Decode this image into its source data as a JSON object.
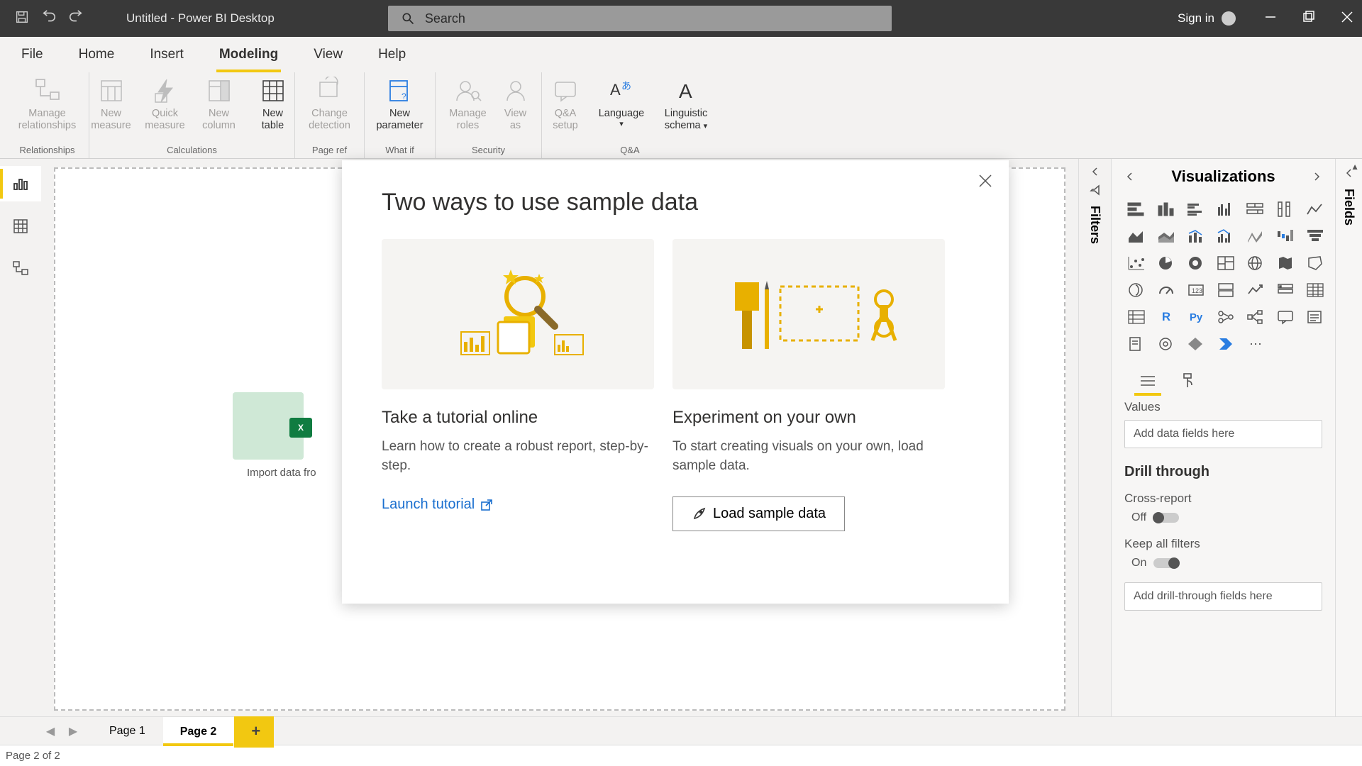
{
  "titlebar": {
    "title": "Untitled - Power BI Desktop",
    "search_placeholder": "Search",
    "signin": "Sign in"
  },
  "menus": [
    "File",
    "Home",
    "Insert",
    "Modeling",
    "View",
    "Help"
  ],
  "menu_active": "Modeling",
  "ribbon": {
    "groups": [
      {
        "label": "Relationships",
        "items": [
          {
            "label1": "Manage",
            "label2": "relationships",
            "disabled": true
          }
        ]
      },
      {
        "label": "Calculations",
        "items": [
          {
            "label1": "New",
            "label2": "measure",
            "disabled": true
          },
          {
            "label1": "Quick",
            "label2": "measure",
            "disabled": true
          },
          {
            "label1": "New",
            "label2": "column",
            "disabled": true
          },
          {
            "label1": "New",
            "label2": "table",
            "disabled": false
          }
        ]
      },
      {
        "label": "Page ref",
        "items": [
          {
            "label1": "Change",
            "label2": "detection",
            "disabled": true
          }
        ]
      },
      {
        "label": "What if",
        "items": [
          {
            "label1": "New",
            "label2": "parameter",
            "disabled": false
          }
        ]
      },
      {
        "label": "Security",
        "items": [
          {
            "label1": "Manage",
            "label2": "roles",
            "disabled": true
          },
          {
            "label1": "View",
            "label2": "as",
            "disabled": true
          }
        ]
      },
      {
        "label": "Q&A",
        "items": [
          {
            "label1": "Q&A",
            "label2": "setup",
            "disabled": true
          },
          {
            "label1": "Language",
            "label2": "",
            "disabled": false,
            "dropdown": true
          },
          {
            "label1": "Linguistic",
            "label2": "schema",
            "disabled": false,
            "dropdown": true
          }
        ]
      }
    ]
  },
  "canvas": {
    "import_label": "Import data fro"
  },
  "modal": {
    "title": "Two ways to use sample data",
    "left": {
      "title": "Take a tutorial online",
      "body": "Learn how to create a robust report, step-by-step.",
      "link": "Launch tutorial"
    },
    "right": {
      "title": "Experiment on your own",
      "body": "To start creating visuals on your own, load sample data.",
      "button": "Load sample data"
    }
  },
  "filters_label": "Filters",
  "vis": {
    "title": "Visualizations",
    "values_label": "Values",
    "values_placeholder": "Add data fields here",
    "drillthrough": "Drill through",
    "cross_report": "Cross-report",
    "off": "Off",
    "keep_all": "Keep all filters",
    "on": "On",
    "drill_placeholder": "Add drill-through fields here"
  },
  "fields_label": "Fields",
  "pages": {
    "tabs": [
      "Page 1",
      "Page 2"
    ],
    "active": 1,
    "status": "Page 2 of 2"
  }
}
